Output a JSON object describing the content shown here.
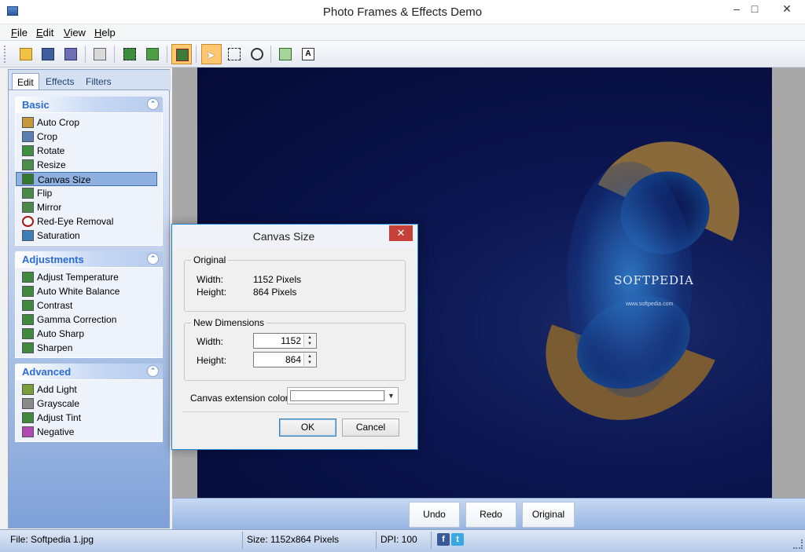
{
  "window": {
    "title": "Photo Frames & Effects Demo"
  },
  "menu": {
    "items": [
      "File",
      "Edit",
      "View",
      "Help"
    ]
  },
  "toolbar": {
    "icons": [
      "open-icon",
      "save-icon",
      "save-as-icon",
      "print-icon",
      "crop-select-icon",
      "add-image-icon",
      "frame-effects-icon",
      "pointer-icon",
      "rect-select-icon",
      "zoom-icon",
      "copy-icon",
      "text-icon"
    ]
  },
  "left_panel": {
    "tabs": [
      "Edit",
      "Effects",
      "Filters"
    ],
    "active_tab": "Edit",
    "groups": {
      "basic": {
        "title": "Basic",
        "items": [
          "Auto Crop",
          "Crop",
          "Rotate",
          "Resize",
          "Canvas Size",
          "Flip",
          "Mirror",
          "Red-Eye Removal",
          "Saturation"
        ],
        "selected": "Canvas Size"
      },
      "adjustments": {
        "title": "Adjustments",
        "items": [
          "Adjust Temperature",
          "Auto White Balance",
          "Contrast",
          "Gamma Correction",
          "Auto Sharp",
          "Sharpen"
        ]
      },
      "advanced": {
        "title": "Advanced",
        "items": [
          "Add Light",
          "Grayscale",
          "Adjust Tint",
          "Negative"
        ]
      }
    }
  },
  "image": {
    "watermark": "SOFTPEDIA",
    "url_text": "www.softpedia.com"
  },
  "actions": {
    "undo": "Undo",
    "redo": "Redo",
    "original": "Original"
  },
  "status": {
    "file": "File: Softpedia 1.jpg",
    "size": "Size: 1152x864 Pixels",
    "dpi": "DPI: 100"
  },
  "dialog": {
    "title": "Canvas Size",
    "original": {
      "legend": "Original",
      "width_label": "Width:",
      "width_value": "1152 Pixels",
      "height_label": "Height:",
      "height_value": "864 Pixels"
    },
    "new_dimensions": {
      "legend": "New Dimensions",
      "width_label": "Width:",
      "width_value": "1152",
      "height_label": "Height:",
      "height_value": "864"
    },
    "extension_color_label": "Canvas extension color:",
    "extension_color": "#ffffff",
    "ok": "OK",
    "cancel": "Cancel"
  },
  "colors": {
    "accent": "#2b6bd3",
    "selection": "#8fb1e0",
    "dialog_border": "#1e87d6",
    "close_red": "#c7413a"
  }
}
